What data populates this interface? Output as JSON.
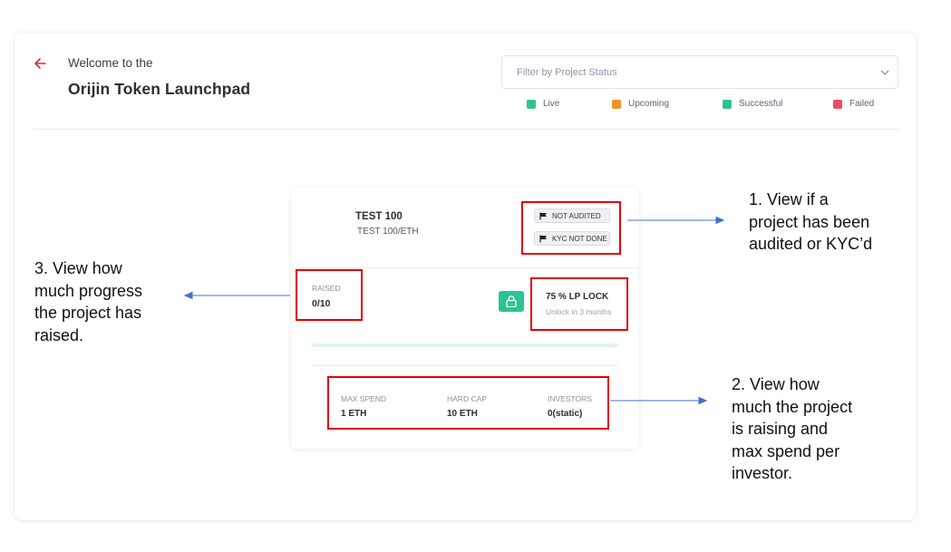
{
  "header": {
    "welcome": "Welcome to the",
    "title": "Orijin Token Launchpad"
  },
  "filter": {
    "placeholder": "Filter by Project Status"
  },
  "legend": [
    {
      "label": "Live",
      "color": "#2fc393"
    },
    {
      "label": "Upcoming",
      "color": "#f4901e"
    },
    {
      "label": "Successful",
      "color": "#2fc393"
    },
    {
      "label": "Failed",
      "color": "#f04c5c"
    }
  ],
  "project": {
    "name": "TEST 100",
    "pair": "TEST 100/ETH",
    "badges": [
      "NOT AUDITED",
      "KYC NOT DONE"
    ],
    "raised_label": "RAISED",
    "raised_value": "0/10",
    "progress_fraction": 0,
    "lp_lock": "75 % LP LOCK",
    "unlock": "Unlock in 3 months",
    "stats": [
      {
        "label": "MAX SPEND",
        "value": "1 ETH"
      },
      {
        "label": "HARD CAP",
        "value": "10 ETH"
      },
      {
        "label": "INVESTORS",
        "value": "0(static)"
      }
    ]
  },
  "annotations": {
    "one": [
      "1. View if a",
      "project has been",
      "audited or KYC’d"
    ],
    "two": [
      "2. View how",
      "much the project",
      "is raising and",
      "max spend per",
      "investor."
    ],
    "three": [
      "3. View how",
      "much progress",
      "the project has",
      "raised."
    ]
  },
  "colors": {
    "accent": "#2fc393",
    "annotation_red": "#e00000",
    "arrow_blue": "#4472c4",
    "back_arrow": "#e0263c"
  }
}
